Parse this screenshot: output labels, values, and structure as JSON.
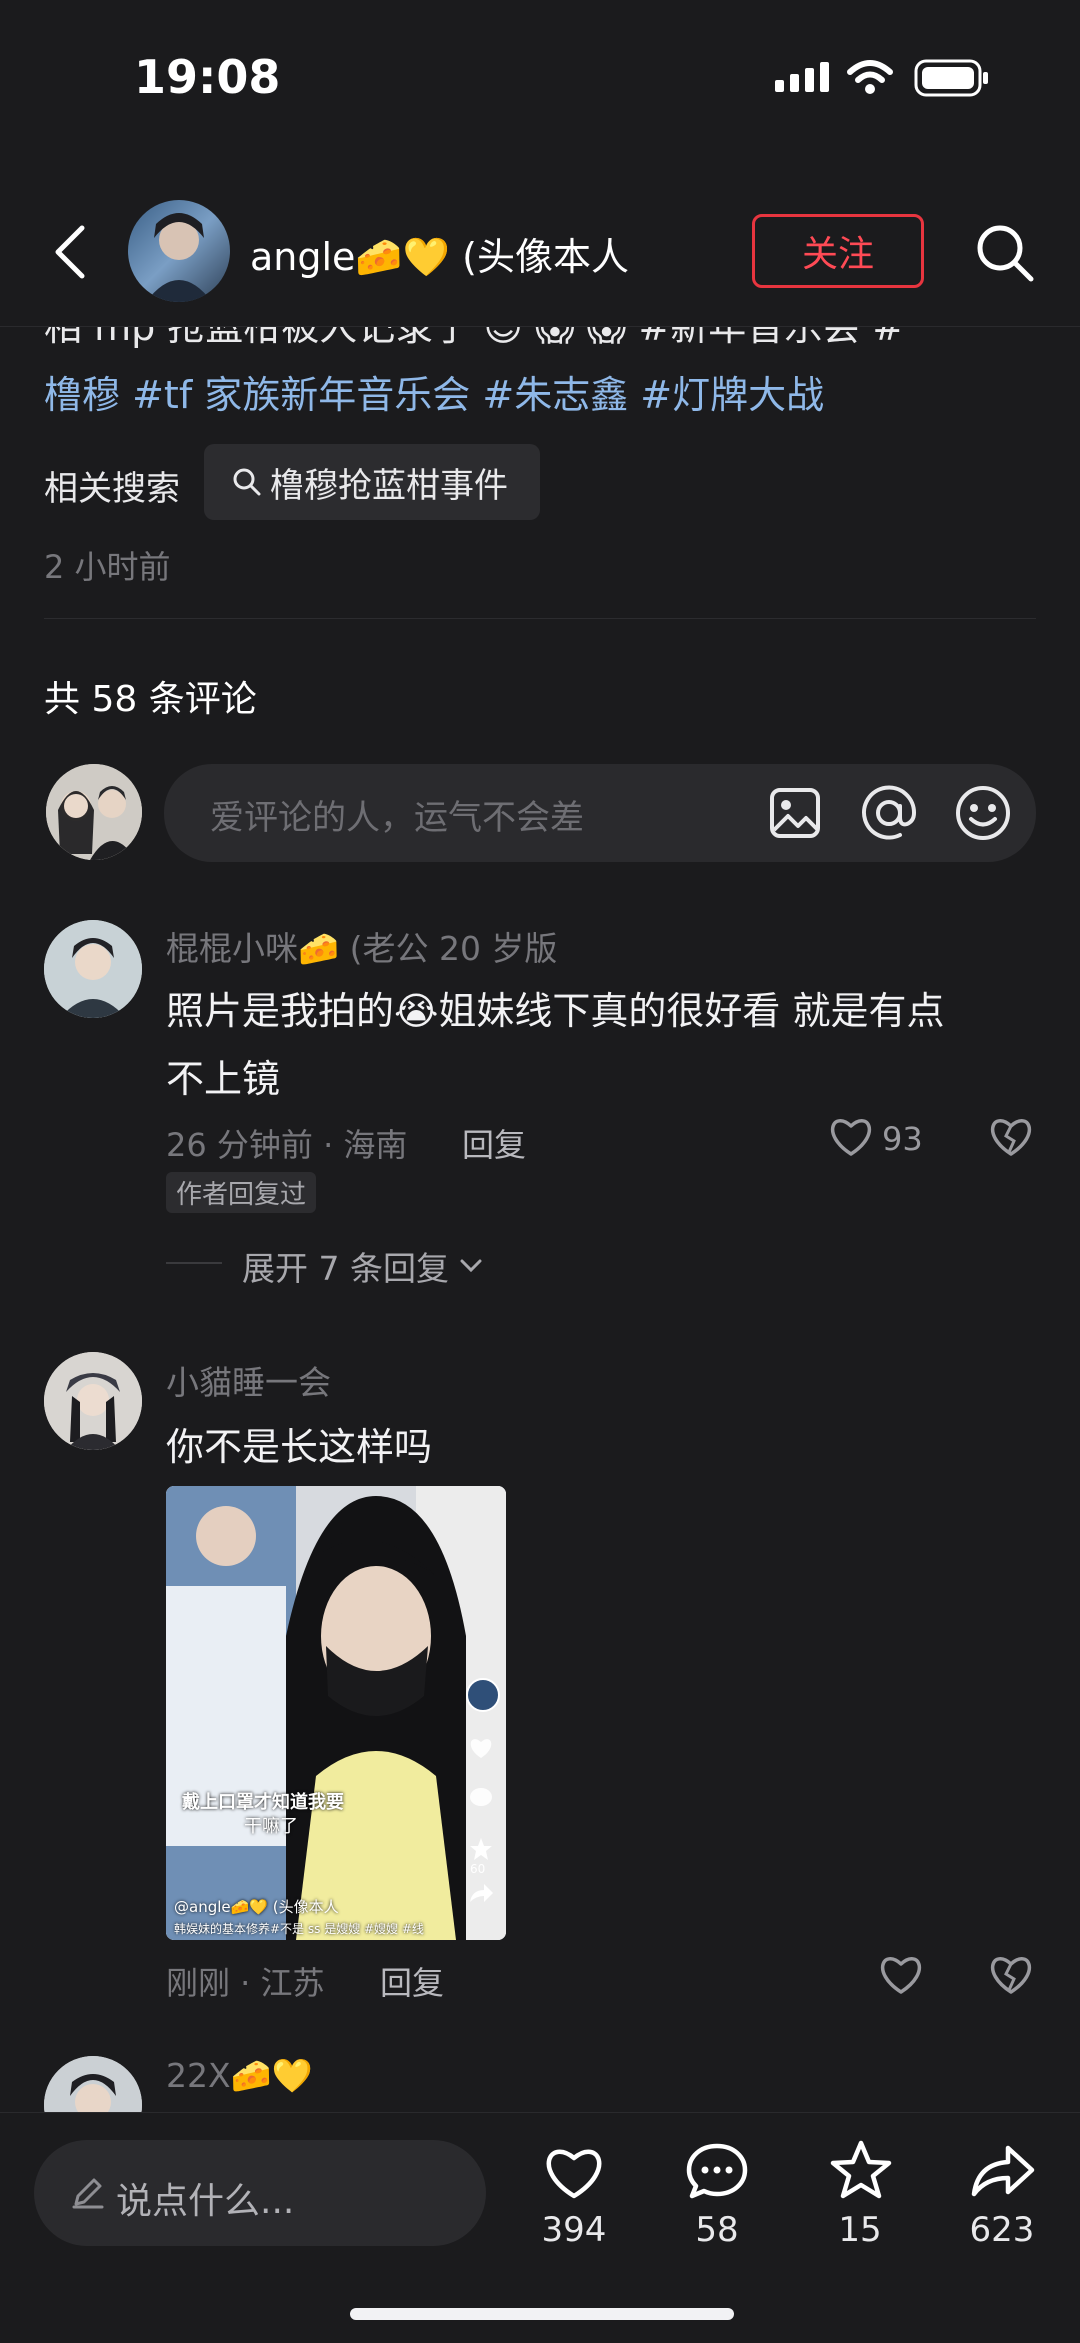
{
  "status_bar": {
    "time": "19:08"
  },
  "header": {
    "username": "angle🧀💛 (头像本人",
    "follow": "关注"
  },
  "post": {
    "line1": "相 mp 抢蓝柑被人记录了 😊 😱 😱 #新年音乐会 #",
    "line2": "橹穆 #tf 家族新年音乐会 #朱志鑫 #灯牌大战",
    "related_label": "相关搜索",
    "related_query": "橹穆抢蓝柑事件",
    "time": "2 小时前"
  },
  "comments_header": "共 58 条评论",
  "comment_input": {
    "placeholder": "爱评论的人，运气不会差"
  },
  "comments": [
    {
      "user": "棍棍小咪🧀 (老公 20 岁版",
      "text1": "照片是我拍的😭姐妹线下真的很好看 就是有点",
      "text2": "不上镜",
      "meta": "26 分钟前 · 海南",
      "reply": "回复",
      "likes": "93",
      "badge": "作者回复过",
      "expand": "展开 7 条回复"
    },
    {
      "user": "小貓睡一会",
      "text1": "你不是长这样吗",
      "meta": "刚刚 · 江苏",
      "reply": "回复",
      "image": {
        "overlay_line1": "戴上口罩才知道我要",
        "overlay_line2": "干嘛了",
        "author": "@angle🧀💛 (头像本人",
        "caption": "韩娱妹的基本修养#不是 ss 是嫂嫂 #嫂嫂 #线",
        "like_count": "60"
      }
    },
    {
      "user": "22X🧀💛"
    }
  ],
  "bottom_bar": {
    "input_placeholder": "说点什么...",
    "likes": "394",
    "comments": "58",
    "stars": "15",
    "shares": "623"
  },
  "colors": {
    "accent_red": "#e8353f",
    "tag_blue": "#8fb8e8",
    "background": "#1b1b1d"
  }
}
